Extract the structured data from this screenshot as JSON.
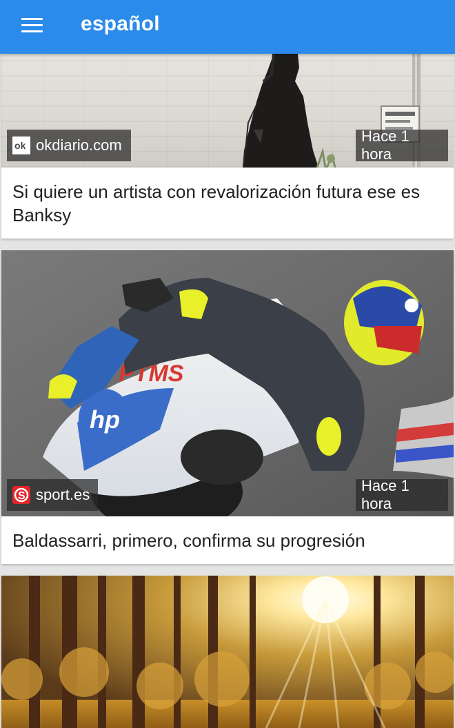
{
  "appbar": {
    "title": "español",
    "color": "#2b8bea"
  },
  "icons": {
    "menu": "hamburger-menu-icon",
    "okdiario": "okdiario-logo",
    "sport": "sport-logo"
  },
  "articles": [
    {
      "source": "okdiario.com",
      "time": "Hace 1 hora",
      "title": "Si quiere un artista con revalorización futura ese es Banksy",
      "image": "street-art-girl-banksy"
    },
    {
      "source": "sport.es",
      "time": "Hace 1 hora",
      "title": "Baldassarri, primero, confirma su progresión",
      "image": "motogp-rider-cornering"
    },
    {
      "source": "",
      "time": "",
      "title": "",
      "image": "sunlit-autumn-forest"
    }
  ]
}
